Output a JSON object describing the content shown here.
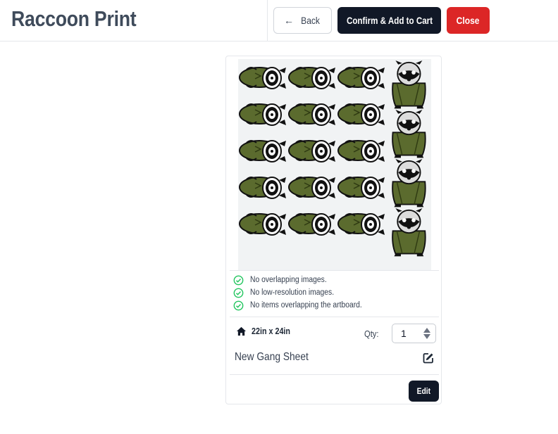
{
  "header": {
    "app_title": "Raccoon Print",
    "back_label": "Back",
    "confirm_label": "Confirm & Add to Cart",
    "close_label": "Close"
  },
  "checks": [
    {
      "label": "No overlapping images."
    },
    {
      "label": "No low-resolution images."
    },
    {
      "label": "No items overlapping the artboard."
    }
  ],
  "sheet": {
    "size": "22in x 24in",
    "qty_label": "Qty:",
    "qty_value": "1",
    "name": "New Gang Sheet",
    "edit_label": "Edit"
  },
  "colors": {
    "primary": "#111827",
    "danger": "#dc2626",
    "check": "#22c55e",
    "raccoon_coat": "#5b6b2e"
  },
  "icons": [
    "left-arrow-icon",
    "check-circle-icon",
    "home-icon",
    "edit-square-icon"
  ]
}
